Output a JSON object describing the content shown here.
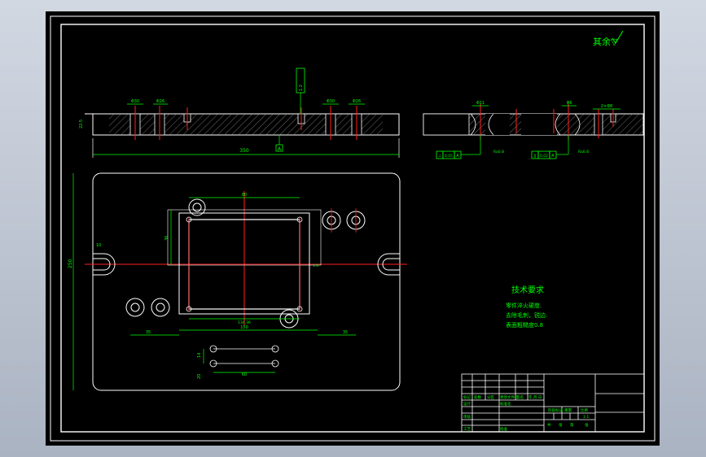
{
  "drawing": {
    "roughness_note": "其余▽",
    "tech_title": "技术要求",
    "tech_lines": [
      "零件淬火硬度.",
      "去除毛刺，锐边.",
      "表面粗糙度0.8"
    ],
    "dims": {
      "overall_length": "350",
      "overall_height": "250",
      "inner_width": "80",
      "left_offset": "35",
      "bottom_width": "150",
      "right_offset": "35",
      "inner_width_lower": "134.36",
      "hole_spacing": "60",
      "slot_depth": "10",
      "pin_height": "14",
      "pin_base": "20",
      "left_thickness": "22.5",
      "counterbore_a": "Φ30",
      "counterbore_b": "Φ26",
      "counterbore_c": "Φ30",
      "counterbore_d": "Φ26",
      "section_a": "Φ11",
      "section_b": "Φ6",
      "section_c": "2×Φ8",
      "left_vert": "36",
      "tol_tag": "A",
      "flatness": "1.2",
      "ftol_a_sym": "⊥",
      "ftol_a_val": "0.05",
      "ftol_a_ref": "A",
      "ftol_a_note": "Ra0.8",
      "ftol_b_sym": "∥",
      "ftol_b_val": "0.02",
      "ftol_b_ref": "A",
      "ftol_b_note": "Ra0.8",
      "side_dim": "1.6"
    },
    "title_block": {
      "r_design": "设计",
      "r_check": "审核",
      "r_process": "工艺",
      "mark": "标记",
      "count": "处数",
      "zone": "分区",
      "doc_no": "更改文件号",
      "sign": "签名",
      "date": "年.月.日",
      "std": "标准化",
      "approve": "批准",
      "stage": "阶段标记",
      "weight": "重量",
      "ratio": "比例",
      "ratio_val": "1:1",
      "sheet_total": "共",
      "sheet_no": "张",
      "sheet": "第"
    }
  }
}
